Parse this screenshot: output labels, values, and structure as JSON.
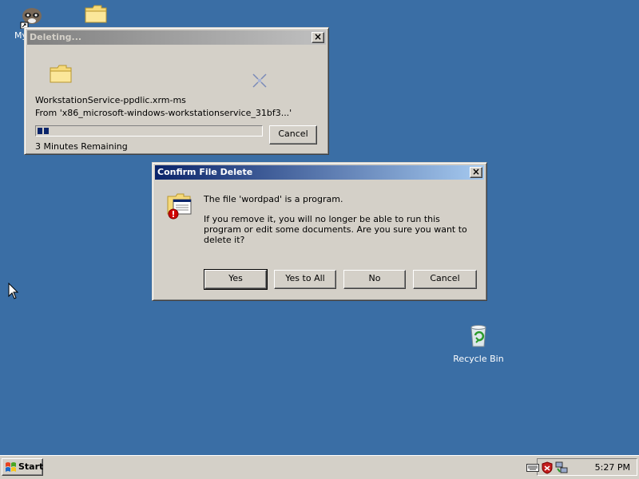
{
  "desktop": {
    "icons": [
      {
        "label": "My"
      },
      {
        "label": ""
      },
      {
        "label": "Recycle Bin"
      }
    ]
  },
  "deleting_dialog": {
    "title": "Deleting...",
    "file_name": "WorkstationService-ppdlic.xrm-ms",
    "from_text": "From 'x86_microsoft-windows-workstationservice_31bf3...'",
    "time_remaining": "3 Minutes Remaining",
    "cancel_label": "Cancel",
    "progress_fraction": 0.05
  },
  "confirm_dialog": {
    "title": "Confirm File Delete",
    "message_line1": "The file 'wordpad' is a program.",
    "message_line2": "If you remove it, you will no longer be able to run this program or edit some documents. Are you sure you want to delete it?",
    "buttons": {
      "yes": "Yes",
      "yes_to_all": "Yes to All",
      "no": "No",
      "cancel": "Cancel"
    }
  },
  "taskbar": {
    "start_label": "Start",
    "clock": "5:27 PM"
  },
  "colors": {
    "desktop": "#3a6ea5",
    "active_title": "#0a246a",
    "face": "#d4d0c8"
  }
}
